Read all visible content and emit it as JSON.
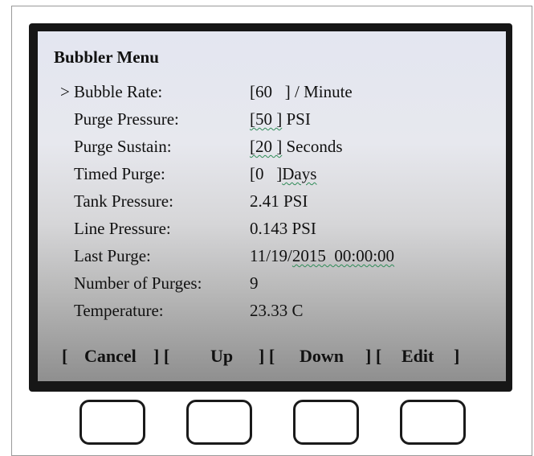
{
  "screen": {
    "title": "Bubbler Menu",
    "cursor": ">",
    "rows": [
      {
        "label": "Bubble Rate:",
        "value": "[60   ] / Minute"
      },
      {
        "label": "Purge Pressure:",
        "value_bracket": "[50 ]",
        "value_unit": " PSI"
      },
      {
        "label": "Purge Sustain:",
        "value_bracket": "[20 ]",
        "value_unit": " Seconds"
      },
      {
        "label": "Timed Purge:",
        "value_bracket": "[0   ]",
        "value_unit": "Days"
      },
      {
        "label": "Tank Pressure:",
        "value": "2.41 PSI"
      },
      {
        "label": "Line Pressure:",
        "value": "0.143 PSI"
      },
      {
        "label": "Last Purge:",
        "value_date": "11/19/",
        "value_rest": "2015  00:00:00"
      },
      {
        "label": "Number of Purges:",
        "value": "9"
      },
      {
        "label": "Temperature:",
        "value": "23.33 C"
      }
    ],
    "softkeys": {
      "open1": "[",
      "cancel": "Cancel",
      "sep1": "] [",
      "up": "Up",
      "sep2": "] [",
      "down": "Down",
      "sep3": "] [",
      "edit": "Edit",
      "close4": "]"
    }
  },
  "hardware_buttons": [
    "softkey-1",
    "softkey-2",
    "softkey-3",
    "softkey-4"
  ]
}
